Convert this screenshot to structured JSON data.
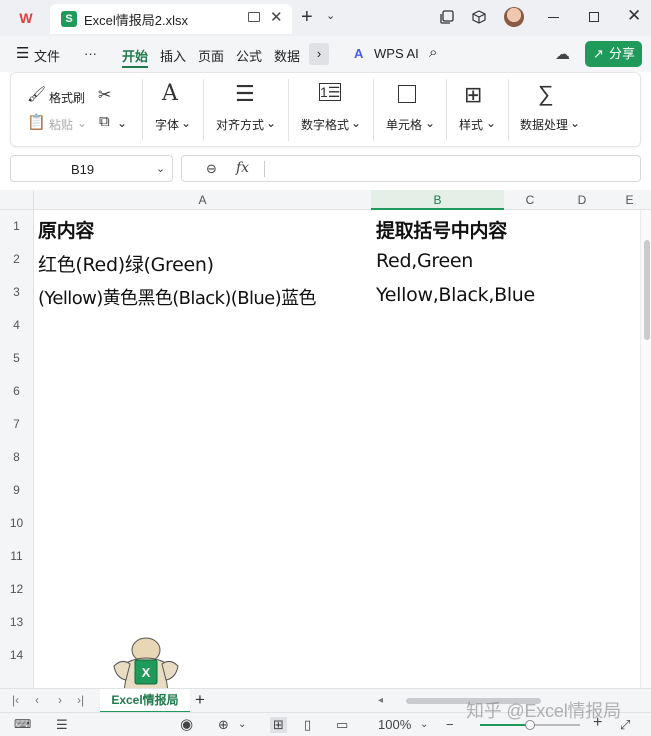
{
  "window": {
    "tab_title": "Excel情报局2.xlsx",
    "file_badge": "S",
    "colors": {
      "accent": "#1f9a5b",
      "wps_red": "#e23b3b"
    }
  },
  "menu": {
    "file": "文件",
    "more": "···",
    "tabs": [
      "开始",
      "插入",
      "页面",
      "公式",
      "数据"
    ],
    "active_tab": "开始",
    "wps_ai": "WPS AI",
    "share": "分享"
  },
  "ribbon": {
    "format_painter": "格式刷",
    "paste": "粘贴",
    "font": "字体",
    "align": "对齐方式",
    "number_format": "数字格式",
    "cell": "单元格",
    "style": "样式",
    "data_processing": "数据处理"
  },
  "formula_bar": {
    "name_box": "B19",
    "fx": "fx",
    "content": ""
  },
  "grid": {
    "columns": [
      "A",
      "B",
      "C",
      "D",
      "E"
    ],
    "selected_column": "B",
    "rows": [
      "1",
      "2",
      "3",
      "4",
      "5",
      "6",
      "7",
      "8",
      "9",
      "10",
      "11",
      "12",
      "13",
      "14"
    ],
    "cells": {
      "A1": "原内容",
      "B1": "提取括号中内容",
      "A2": "红色(Red)绿(Green)",
      "B2": "Red,Green",
      "A3": "(Yellow)黄色黑色(Black)(Blue)蓝色",
      "B3": "Yellow,Black,Blue"
    }
  },
  "sheets": {
    "tabs": [
      "Excel情报局"
    ],
    "active": "Excel情报局"
  },
  "status": {
    "zoom_percent": "100%",
    "zoom_level": 0.5
  },
  "watermark": "知乎 @Excel情报局"
}
